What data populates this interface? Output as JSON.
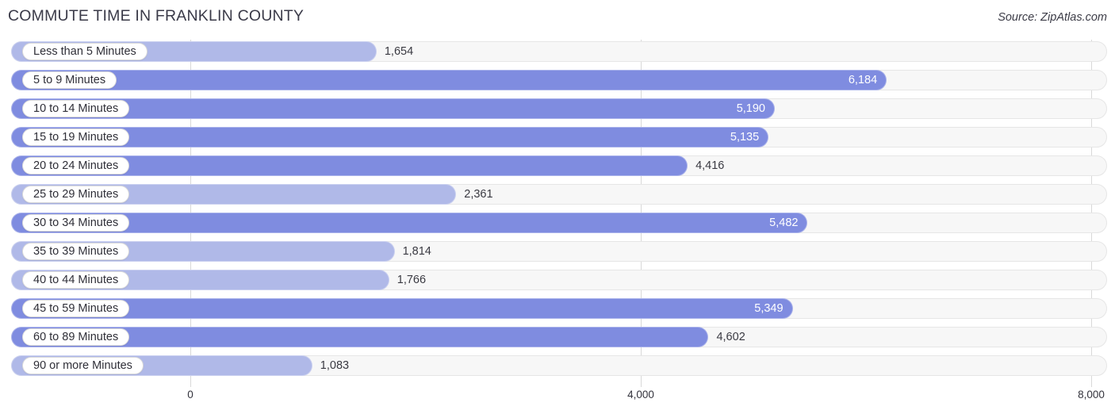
{
  "header": {
    "title": "COMMUTE TIME IN FRANKLIN COUNTY",
    "source": "Source: ZipAtlas.com"
  },
  "chart_data": {
    "type": "bar",
    "orientation": "horizontal",
    "title": "COMMUTE TIME IN FRANKLIN COUNTY",
    "xlabel": "",
    "ylabel": "",
    "xlim": [
      0,
      8000
    ],
    "grid": true,
    "gridlines": [
      0,
      4000,
      8000
    ],
    "tick_labels": [
      "0",
      "4,000",
      "8,000"
    ],
    "legend": "none",
    "colors": {
      "bar_light": "#b0b9e8",
      "bar_dark": "#7f8ce0",
      "track": "#f7f7f7",
      "gridline": "#d8d8d8",
      "value_inside_text": "#ffffff",
      "value_outside_text": "#3a3a42"
    },
    "categories": [
      "Less than 5 Minutes",
      "5 to 9 Minutes",
      "10 to 14 Minutes",
      "15 to 19 Minutes",
      "20 to 24 Minutes",
      "25 to 29 Minutes",
      "30 to 34 Minutes",
      "35 to 39 Minutes",
      "40 to 44 Minutes",
      "45 to 59 Minutes",
      "60 to 89 Minutes",
      "90 or more Minutes"
    ],
    "values": [
      1654,
      6184,
      5190,
      5135,
      4416,
      2361,
      5482,
      1814,
      1766,
      5349,
      4602,
      1083
    ],
    "value_labels": [
      "1,654",
      "6,184",
      "5,190",
      "5,135",
      "4,416",
      "2,361",
      "5,482",
      "1,814",
      "1,766",
      "5,349",
      "4,602",
      "1,083"
    ]
  },
  "rows": [
    {
      "label": "Less than 5 Minutes",
      "value": 1654,
      "value_label": "1,654",
      "shade": "light",
      "label_position": "outside"
    },
    {
      "label": "5 to 9 Minutes",
      "value": 6184,
      "value_label": "6,184",
      "shade": "dark",
      "label_position": "inside"
    },
    {
      "label": "10 to 14 Minutes",
      "value": 5190,
      "value_label": "5,190",
      "shade": "dark",
      "label_position": "inside"
    },
    {
      "label": "15 to 19 Minutes",
      "value": 5135,
      "value_label": "5,135",
      "shade": "dark",
      "label_position": "inside"
    },
    {
      "label": "20 to 24 Minutes",
      "value": 4416,
      "value_label": "4,416",
      "shade": "dark",
      "label_position": "outside"
    },
    {
      "label": "25 to 29 Minutes",
      "value": 2361,
      "value_label": "2,361",
      "shade": "light",
      "label_position": "outside"
    },
    {
      "label": "30 to 34 Minutes",
      "value": 5482,
      "value_label": "5,482",
      "shade": "dark",
      "label_position": "inside"
    },
    {
      "label": "35 to 39 Minutes",
      "value": 1814,
      "value_label": "1,814",
      "shade": "light",
      "label_position": "outside"
    },
    {
      "label": "40 to 44 Minutes",
      "value": 1766,
      "value_label": "1,766",
      "shade": "light",
      "label_position": "outside"
    },
    {
      "label": "45 to 59 Minutes",
      "value": 5349,
      "value_label": "5,349",
      "shade": "dark",
      "label_position": "inside"
    },
    {
      "label": "60 to 89 Minutes",
      "value": 4602,
      "value_label": "4,602",
      "shade": "dark",
      "label_position": "outside"
    },
    {
      "label": "90 or more Minutes",
      "value": 1083,
      "value_label": "1,083",
      "shade": "light",
      "label_position": "outside"
    }
  ],
  "axis": {
    "ticks": [
      {
        "label": "0",
        "value": 0
      },
      {
        "label": "4,000",
        "value": 4000
      },
      {
        "label": "8,000",
        "value": 8000
      }
    ]
  }
}
